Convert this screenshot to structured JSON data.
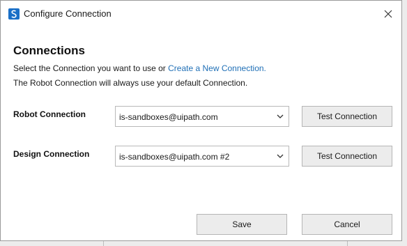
{
  "window": {
    "title": "Configure Connection"
  },
  "heading": "Connections",
  "description": {
    "prefix": "Select the Connection you want to use or ",
    "link": "Create a New Connection.",
    "line2": "The Robot Connection will always use your default Connection."
  },
  "robot_connection": {
    "label": "Robot Connection",
    "selected": "is-sandboxes@uipath.com",
    "test_button": "Test Connection"
  },
  "design_connection": {
    "label": "Design Connection",
    "selected": "is-sandboxes@uipath.com #2",
    "test_button": "Test Connection"
  },
  "footer": {
    "save_label": "Save",
    "cancel_label": "Cancel"
  },
  "colors": {
    "brand_icon": "#1a6fc7",
    "link": "#1f6fb6"
  }
}
